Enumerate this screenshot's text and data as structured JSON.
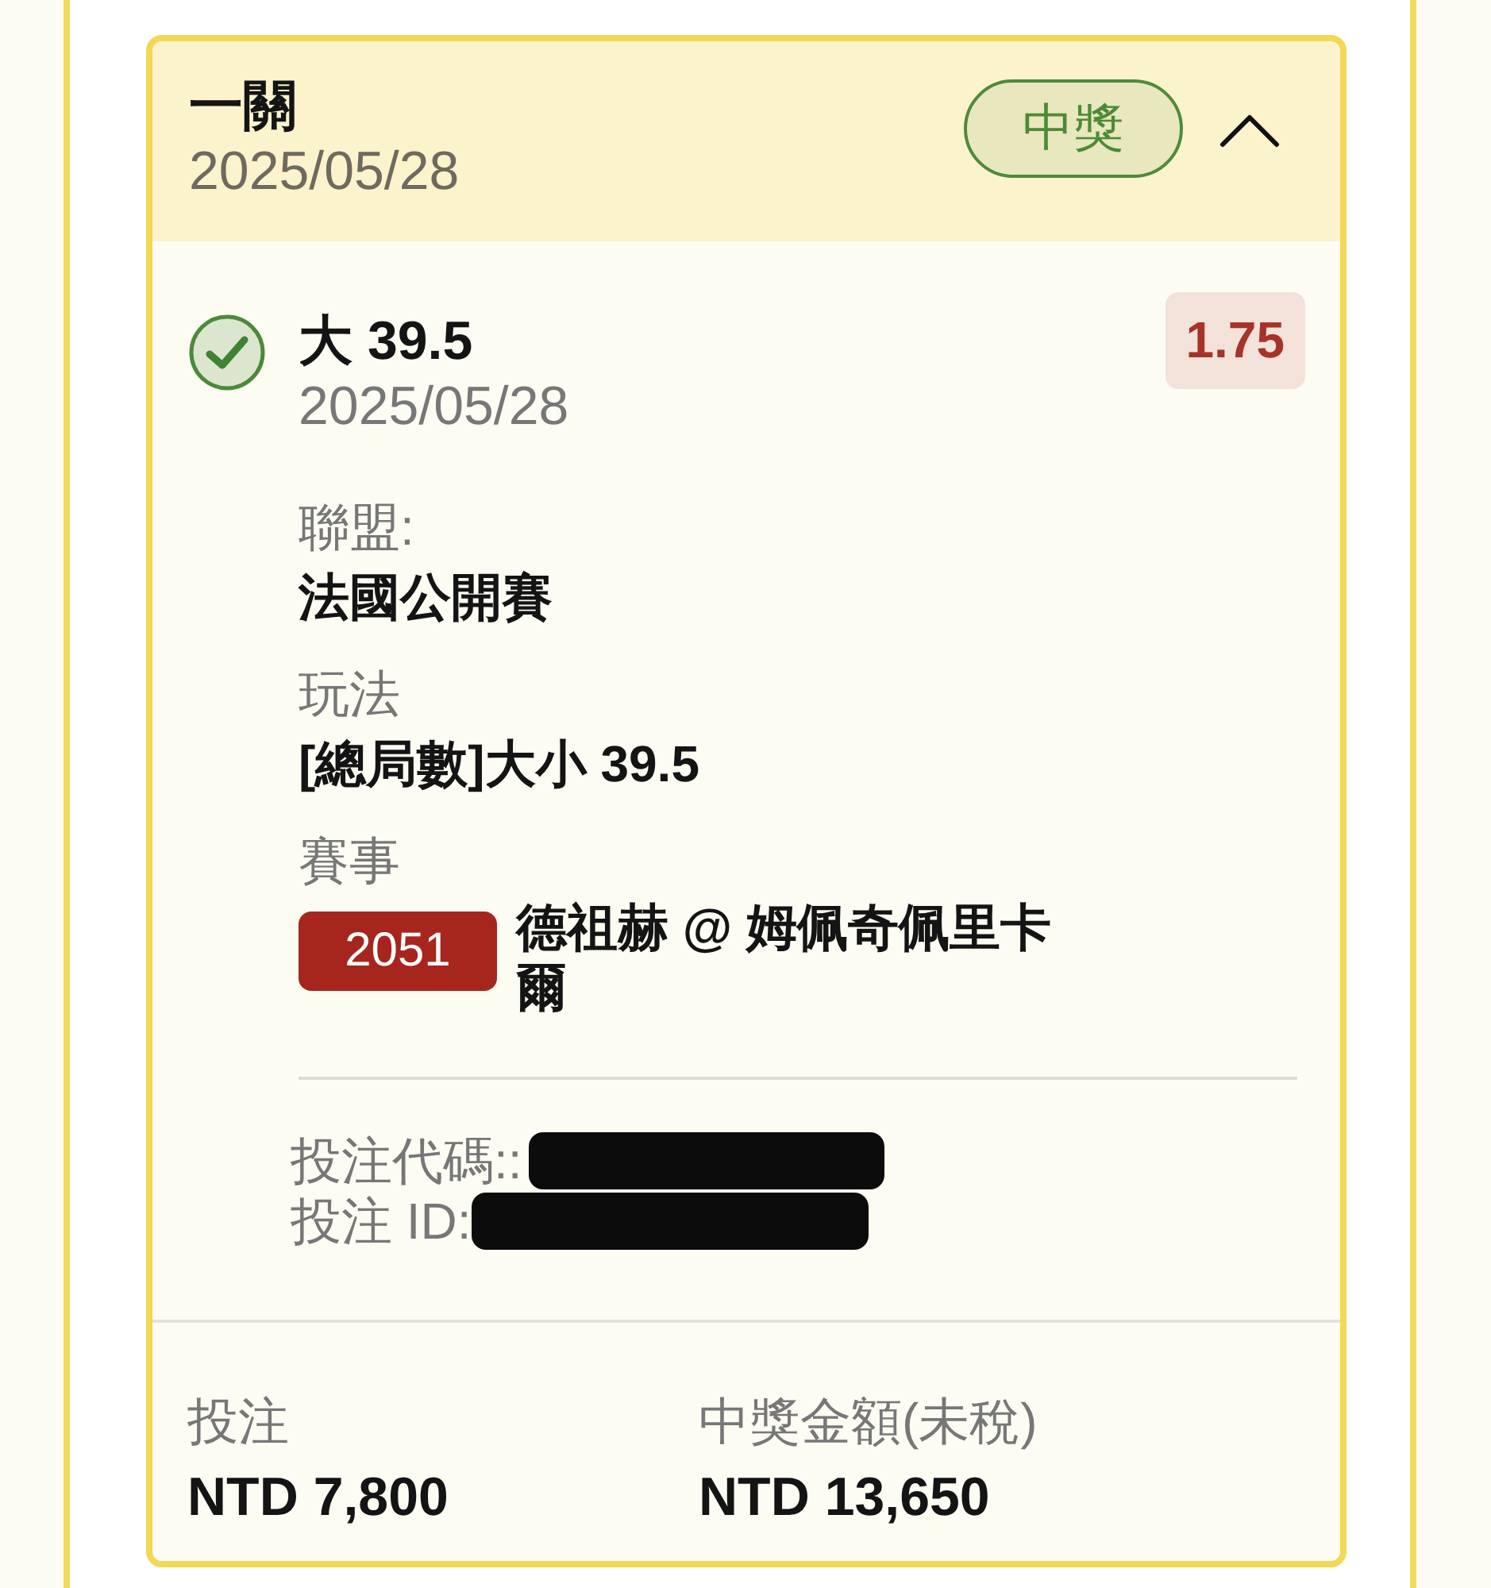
{
  "header": {
    "title": "一關",
    "date": "2025/05/28",
    "status_badge": "中獎",
    "expanded": true
  },
  "selection": {
    "checked": true,
    "title": "大 39.5",
    "date": "2025/05/28",
    "odds": "1.75"
  },
  "details": [
    {
      "kind": "text",
      "label": "聯盟:",
      "value": "法國公開賽"
    },
    {
      "kind": "text",
      "label": "玩法",
      "value": "[總局數]大小 39.5"
    },
    {
      "kind": "match",
      "label": "賽事",
      "number": "2051",
      "value": "德祖赫 @ 姆佩奇佩里卡爾"
    }
  ],
  "references": [
    {
      "label": "投注代碼::",
      "redacted": true
    },
    {
      "label": "投注 ID:",
      "redacted": true
    }
  ],
  "totals": [
    {
      "label": "投注",
      "value": "NTD 7,800"
    },
    {
      "label": "中獎金額(未稅)",
      "value": "NTD 13,650"
    }
  ]
}
